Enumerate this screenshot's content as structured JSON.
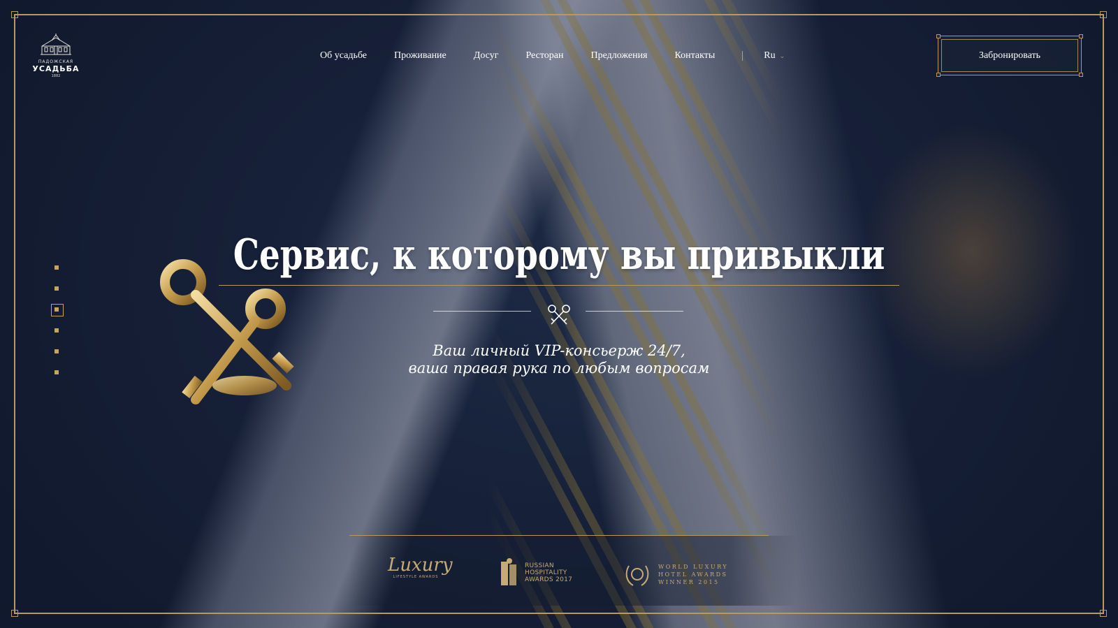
{
  "brand": {
    "logo_top": "ПАДОЖСКАЯ",
    "logo_main": "УСАДЬБА",
    "logo_year": "1882"
  },
  "nav": {
    "items": [
      {
        "label": "Об усадьбе"
      },
      {
        "label": "Проживание"
      },
      {
        "label": "Досуг"
      },
      {
        "label": "Ресторан"
      },
      {
        "label": "Предложения"
      },
      {
        "label": "Контакты"
      }
    ],
    "language": "Ru"
  },
  "booking": {
    "label": "Забронировать"
  },
  "slider": {
    "count": 6,
    "active_index": 2
  },
  "hero": {
    "title": "Сервис, к которому вы привыкли",
    "subtitle_line1": "Ваш личный VIP-консьерж 24/7,",
    "subtitle_line2": "ваша правая рука по любым вопросам"
  },
  "awards": {
    "luxury": {
      "main": "Luxury",
      "small": "LIFESTYLE AWARDS"
    },
    "rha": {
      "line1": "RUSSIAN",
      "line2": "HOSPITALITY",
      "line3": "AWARDS 2017"
    },
    "wlh": {
      "line1": "WORLD LUXURY",
      "line2": "HOTEL AWARDS",
      "line3": "WINNER 2015"
    }
  },
  "colors": {
    "accent": "#b89a5e",
    "background": "#18223b"
  },
  "icons": [
    "crossed-keys-icon",
    "chevron-down-icon",
    "manor-logo-icon"
  ]
}
